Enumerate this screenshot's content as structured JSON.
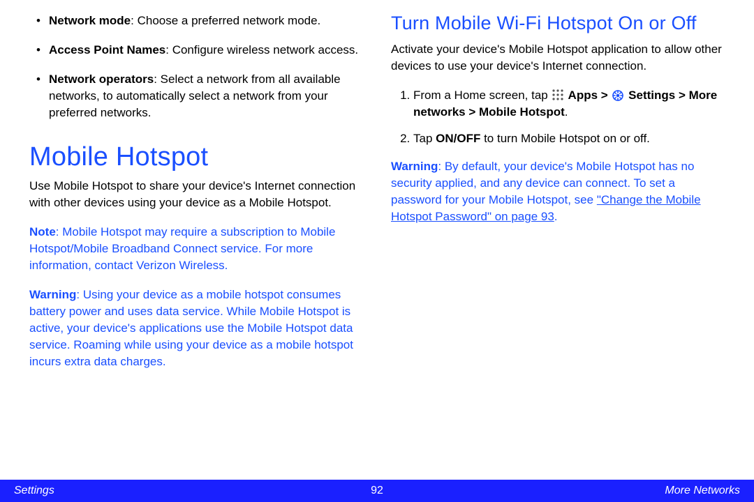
{
  "left": {
    "bullets": [
      {
        "term": "Network mode",
        "desc": ": Choose a preferred network mode."
      },
      {
        "term": "Access Point Names",
        "desc": ": Configure wireless network access."
      },
      {
        "term": "Network operators",
        "desc": ": Select a network from all available networks, to automatically select a network from your preferred networks."
      }
    ],
    "section_title": "Mobile Hotspot",
    "intro": "Use Mobile Hotspot to share your device's Internet connection with other devices using your device as a Mobile Hotspot.",
    "note_label": "Note",
    "note_body": ": Mobile Hotspot may require a subscription to Mobile Hotspot/Mobile Broadband Connect service. For more information, contact Verizon Wireless.",
    "warning_label": "Warning",
    "warning_body": ": Using your device as a mobile hotspot consumes battery power and uses data service. While Mobile Hotspot is active, your device's applications use the Mobile Hotspot data service. Roaming while using your device as a mobile hotspot incurs extra data charges."
  },
  "right": {
    "sub_title": "Turn Mobile Wi-Fi Hotspot On or Off",
    "intro": "Activate your device's Mobile Hotspot application to allow other devices to use your device's Internet connection.",
    "step1_pre": "From a Home screen, tap ",
    "step1_apps": " Apps > ",
    "step1_settings": " Settings > More networks > Mobile Hotspot",
    "step1_dot": ".",
    "step2_pre": "Tap ",
    "step2_bold": "ON/OFF",
    "step2_post": " to turn Mobile Hotspot on or off.",
    "warn_label": "Warning",
    "warn_body_a": ": By default, your device's Mobile Hotspot has no security applied, and any device can connect. To set a password for your Mobile Hotspot, see ",
    "warn_link": "\"Change the Mobile Hotspot Password\" on page 93",
    "warn_body_b": "."
  },
  "footer": {
    "left": "Settings",
    "page": "92",
    "right": "More Networks"
  }
}
